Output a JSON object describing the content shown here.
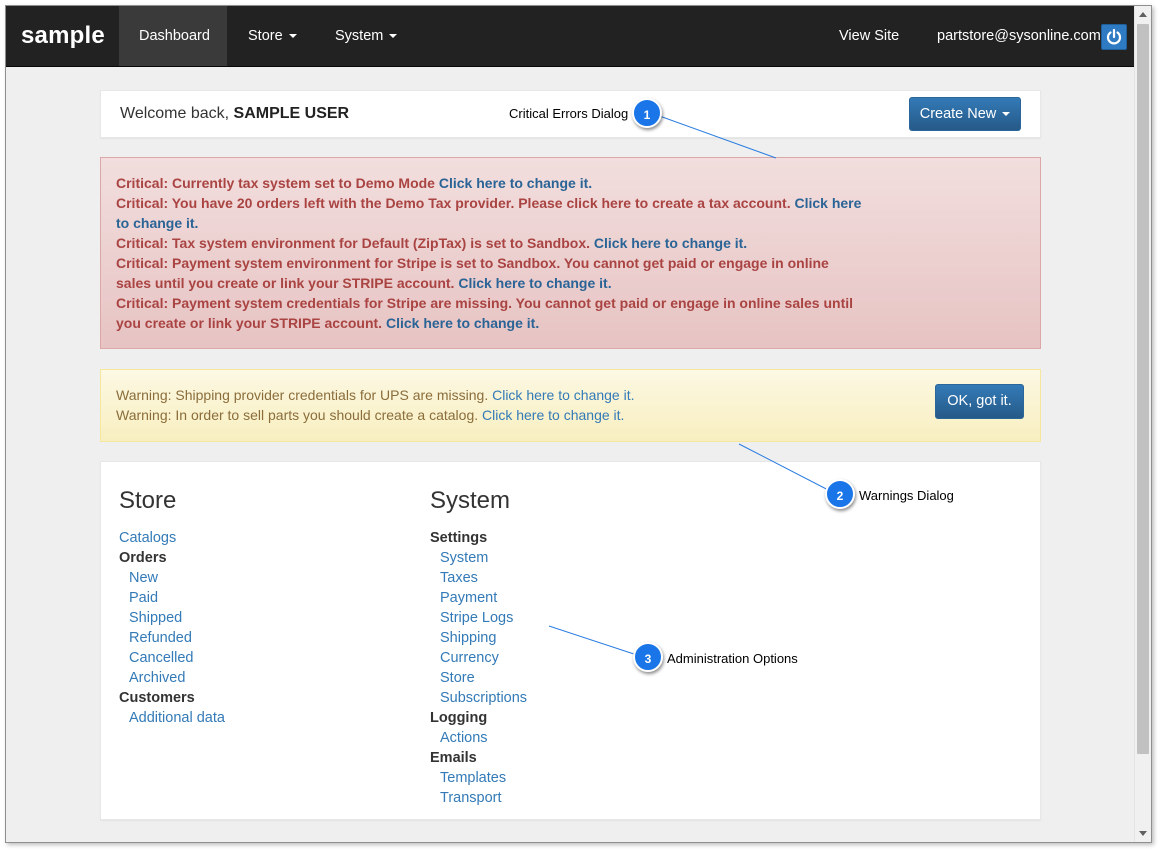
{
  "navbar": {
    "brand": "sample",
    "items": [
      {
        "label": "Dashboard",
        "active": true
      },
      {
        "label": "Store",
        "dropdown": true
      },
      {
        "label": "System",
        "dropdown": true
      }
    ],
    "view_site": "View Site",
    "user_email": "partstore@sysonline.com",
    "power_icon": "power-icon"
  },
  "welcome": {
    "prefix": "Welcome back,",
    "user_name": "SAMPLE USER",
    "create_new_label": "Create New"
  },
  "critical_errors": [
    {
      "text": "Critical: Currently tax system set to Demo Mode ",
      "link": "Click here to change it."
    },
    {
      "text": "Critical: You have 20 orders left with the Demo Tax provider. Please click here to create a tax account. ",
      "link": "Click here to change it."
    },
    {
      "text": "Critical: Tax system environment for Default (ZipTax) is set to Sandbox. ",
      "link": "Click here to change it."
    },
    {
      "text": "Critical: Payment system environment for Stripe is set to Sandbox. You cannot get paid or engage in online sales until you create or link your STRIPE account. ",
      "link": "Click here to change it."
    },
    {
      "text": "Critical: Payment system credentials for Stripe are missing. You cannot get paid or engage in online sales until you create or link your STRIPE account. ",
      "link": "Click here to change it."
    }
  ],
  "warnings": [
    {
      "text": "Warning: Shipping provider credentials for UPS are missing. ",
      "link": "Click here to change it."
    },
    {
      "text": "Warning: In order to sell parts you should create a catalog. ",
      "link": "Click here to change it."
    }
  ],
  "warnings_ok_label": "OK, got it.",
  "store": {
    "title": "Store",
    "items": [
      {
        "label": "Catalogs",
        "type": "link",
        "indent": false
      },
      {
        "label": "Orders",
        "type": "header",
        "indent": false
      },
      {
        "label": "New",
        "type": "link",
        "indent": true
      },
      {
        "label": "Paid",
        "type": "link",
        "indent": true
      },
      {
        "label": "Shipped",
        "type": "link",
        "indent": true
      },
      {
        "label": "Refunded",
        "type": "link",
        "indent": true
      },
      {
        "label": "Cancelled",
        "type": "link",
        "indent": true
      },
      {
        "label": "Archived",
        "type": "link",
        "indent": true
      },
      {
        "label": "Customers",
        "type": "header",
        "indent": false
      },
      {
        "label": "Additional data",
        "type": "link",
        "indent": true
      }
    ]
  },
  "system": {
    "title": "System",
    "items": [
      {
        "label": "Settings",
        "type": "header",
        "indent": false
      },
      {
        "label": "System",
        "type": "link",
        "indent": true
      },
      {
        "label": "Taxes",
        "type": "link",
        "indent": true
      },
      {
        "label": "Payment",
        "type": "link",
        "indent": true
      },
      {
        "label": "Stripe Logs",
        "type": "link",
        "indent": true
      },
      {
        "label": "Shipping",
        "type": "link",
        "indent": true
      },
      {
        "label": "Currency",
        "type": "link",
        "indent": true
      },
      {
        "label": "Store",
        "type": "link",
        "indent": true
      },
      {
        "label": "Subscriptions",
        "type": "link",
        "indent": true
      },
      {
        "label": "Logging",
        "type": "header",
        "indent": false
      },
      {
        "label": "Actions",
        "type": "link",
        "indent": true
      },
      {
        "label": "Emails",
        "type": "header",
        "indent": false
      },
      {
        "label": "Templates",
        "type": "link",
        "indent": true
      },
      {
        "label": "Transport",
        "type": "link",
        "indent": true
      }
    ]
  },
  "callouts": [
    {
      "number": "1",
      "label": "Critical Errors Dialog"
    },
    {
      "number": "2",
      "label": "Warnings Dialog"
    },
    {
      "number": "3",
      "label": "Administration Options"
    }
  ],
  "colors": {
    "navbar_bg": "#222222",
    "primary": "#337ab7",
    "danger_text": "#a94442",
    "warning_text": "#8a6d3b",
    "callout_badge": "#1a76e8"
  }
}
